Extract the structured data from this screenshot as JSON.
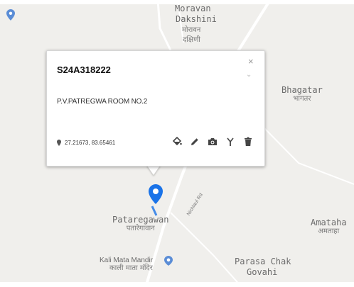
{
  "places": [
    {
      "en": "Moravan",
      "hi": ""
    },
    {
      "en": "Dakshini",
      "hi": ""
    },
    {
      "en": "",
      "hi": "मोरावन"
    },
    {
      "en": "",
      "hi": "दक्षिणी"
    },
    {
      "en": "Bhagatar",
      "hi": "भागतर"
    },
    {
      "en": "Pataregawan",
      "hi": "पतारेगावान"
    },
    {
      "en": "Amataha",
      "hi": "अमताहा"
    },
    {
      "en": "Kali Mata Mandir",
      "hi": "काली माता मंदिर"
    },
    {
      "en": "Parasa Chak",
      "hi": ""
    },
    {
      "en": "Govahi",
      "hi": ""
    }
  ],
  "road_label": "Nichlaul Rd",
  "popup": {
    "title": "S24A318222",
    "address": "P.V.PATREGWA ROOM NO.2",
    "coords": "27.21673, 83.65461",
    "close_symbol": "×"
  },
  "colors": {
    "map_background": "#f0efec",
    "road": "#ffffff",
    "marker": "#1a73e8",
    "poi": "#5b8dd6"
  },
  "icons": [
    "location-pin-icon",
    "paint-bucket-icon",
    "pencil-icon",
    "camera-icon",
    "antenna-icon",
    "trash-icon",
    "close-icon",
    "map-marker-icon"
  ]
}
